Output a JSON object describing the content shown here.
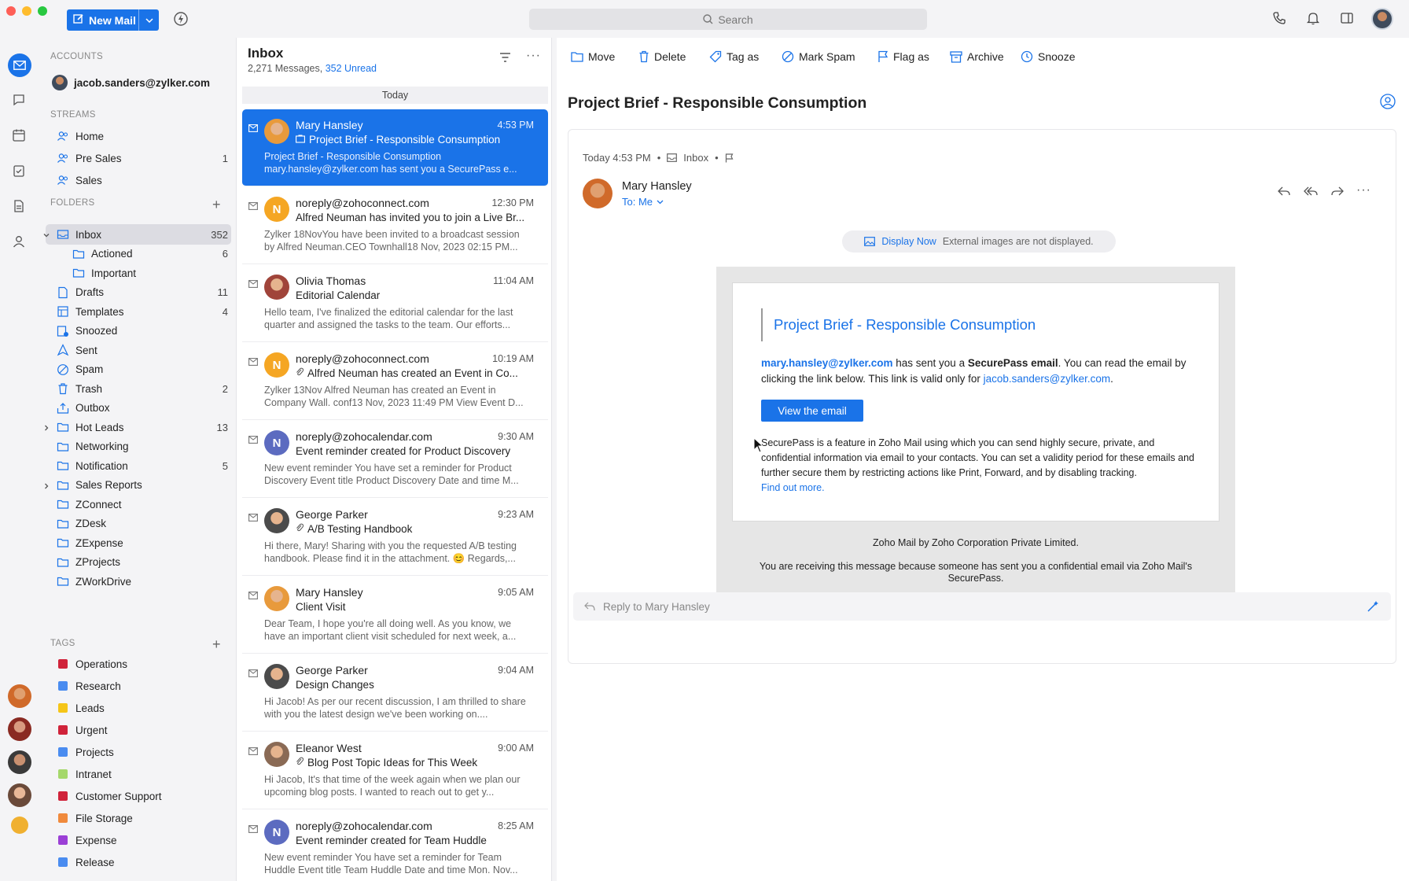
{
  "toolbar": {
    "new_mail_label": "New Mail",
    "search_placeholder": "Search"
  },
  "sidebar": {
    "accounts_header": "ACCOUNTS",
    "account_email": "jacob.sanders@zylker.com",
    "streams_header": "STREAMS",
    "streams": [
      {
        "label": "Home",
        "count": ""
      },
      {
        "label": "Pre Sales",
        "count": "1"
      },
      {
        "label": "Sales",
        "count": ""
      }
    ],
    "folders_header": "FOLDERS",
    "folders": [
      {
        "label": "Inbox",
        "count": "352"
      },
      {
        "label": "Actioned",
        "count": "6"
      },
      {
        "label": "Important",
        "count": ""
      },
      {
        "label": "Drafts",
        "count": "11"
      },
      {
        "label": "Templates",
        "count": "4"
      },
      {
        "label": "Snoozed",
        "count": ""
      },
      {
        "label": "Sent",
        "count": ""
      },
      {
        "label": "Spam",
        "count": ""
      },
      {
        "label": "Trash",
        "count": "2"
      },
      {
        "label": "Outbox",
        "count": ""
      },
      {
        "label": "Hot Leads",
        "count": "13"
      },
      {
        "label": "Networking",
        "count": ""
      },
      {
        "label": "Notification",
        "count": "5"
      },
      {
        "label": "Sales Reports",
        "count": ""
      },
      {
        "label": "ZConnect",
        "count": ""
      },
      {
        "label": "ZDesk",
        "count": ""
      },
      {
        "label": "ZExpense",
        "count": ""
      },
      {
        "label": "ZProjects",
        "count": ""
      },
      {
        "label": "ZWorkDrive",
        "count": ""
      }
    ],
    "tags_header": "TAGS",
    "tags": [
      {
        "label": "Operations",
        "color": "#d0233a"
      },
      {
        "label": "Research",
        "color": "#4a8cf0"
      },
      {
        "label": "Leads",
        "color": "#f5c518"
      },
      {
        "label": "Urgent",
        "color": "#d0233a"
      },
      {
        "label": "Projects",
        "color": "#4a8cf0"
      },
      {
        "label": "Intranet",
        "color": "#a5d86b"
      },
      {
        "label": "Customer Support",
        "color": "#d0233a"
      },
      {
        "label": "File Storage",
        "color": "#f08a3c"
      },
      {
        "label": "Expense",
        "color": "#9b3fd6"
      },
      {
        "label": "Release",
        "color": "#4a8cf0"
      }
    ]
  },
  "list": {
    "title": "Inbox",
    "count": "2,271 Messages,",
    "unread": "352 Unread",
    "section": "Today",
    "messages": [
      {
        "from": "Mary Hansley",
        "time": "4:53 PM",
        "subject": "Project Brief - Responsible Consumption",
        "preview": "Project Brief - Responsible Consumption mary.hansley@zylker.com has sent you a SecurePass e...",
        "avatar": "photo",
        "avatar_color": "#e89a3c"
      },
      {
        "from": "noreply@zohoconnect.com",
        "time": "12:30 PM",
        "subject": "Alfred Neuman has invited you to join a Live Br...",
        "preview": "Zylker 18NovYou have been invited to a broadcast session by Alfred Neuman.CEO Townhall18 Nov, 2023 02:15 PM...",
        "avatar": "N",
        "avatar_color": "#f5a623"
      },
      {
        "from": "Olivia Thomas",
        "time": "11:04 AM",
        "subject": "Editorial Calendar",
        "preview": "Hello team, I've finalized the editorial calendar for the last quarter and assigned the tasks to the team. Our efforts...",
        "avatar": "photo",
        "avatar_color": "#a0443a"
      },
      {
        "from": "noreply@zohoconnect.com",
        "time": "10:19 AM",
        "subject": "Alfred Neuman has created an Event in Co...",
        "preview": "Zylker 13Nov Alfred Neuman has created an Event in Company Wall. conf13 Nov, 2023 11:49 PM View Event D...",
        "avatar": "N",
        "avatar_color": "#f5a623"
      },
      {
        "from": "noreply@zohocalendar.com",
        "time": "9:30 AM",
        "subject": "Event reminder created for Product Discovery",
        "preview": "New event reminder You have set a reminder for Product Discovery Event title Product Discovery Date and time M...",
        "avatar": "N",
        "avatar_color": "#5c6bc0"
      },
      {
        "from": "George Parker",
        "time": "9:23 AM",
        "subject": "A/B Testing Handbook",
        "preview": "Hi there, Mary! Sharing with you the requested A/B testing handbook. Please find it in the attachment. 😊 Regards,...",
        "avatar": "photo",
        "avatar_color": "#4b4b4b"
      },
      {
        "from": "Mary Hansley",
        "time": "9:05 AM",
        "subject": "Client Visit",
        "preview": "Dear Team, I hope you're all doing well. As you know, we have an important client visit scheduled for next week, a...",
        "avatar": "photo",
        "avatar_color": "#e89a3c"
      },
      {
        "from": "George Parker",
        "time": "9:04 AM",
        "subject": "Design Changes",
        "preview": "Hi Jacob! As per our recent discussion, I am thrilled to share with you the latest design we've been working on....",
        "avatar": "photo",
        "avatar_color": "#4b4b4b"
      },
      {
        "from": "Eleanor West",
        "time": "9:00 AM",
        "subject": "Blog Post Topic Ideas for This Week",
        "preview": "Hi Jacob, It's that time of the week again when we plan our upcoming blog posts. I wanted to reach out to get y...",
        "avatar": "photo",
        "avatar_color": "#8a6a55"
      },
      {
        "from": "noreply@zohocalendar.com",
        "time": "8:25 AM",
        "subject": "Event reminder created for Team Huddle",
        "preview": "New event reminder You have set a reminder for Team Huddle Event title Team Huddle Date and time Mon. Nov...",
        "avatar": "N",
        "avatar_color": "#5c6bc0"
      }
    ]
  },
  "reader": {
    "actions": [
      "Move",
      "Delete",
      "Tag as",
      "Mark Spam",
      "Flag as",
      "Archive",
      "Snooze"
    ],
    "subject": "Project Brief - Responsible Consumption",
    "date": "Today 4:53 PM",
    "folder": "Inbox",
    "sender": "Mary Hansley",
    "to": "To: Me",
    "images_link": "Display Now",
    "images_note": "External images are not displayed.",
    "body_title": "Project Brief - Responsible Consumption",
    "body_sender_link": "mary.hansley@zylker.com",
    "body_text1": " has sent you a ",
    "body_bold": "SecurePass email",
    "body_text2": ". You can read the email by clicking the link below. This link is valid only for ",
    "body_recipient_link": "jacob.sanders@zylker.com",
    "body_text3": ".",
    "view_button": "View the email",
    "info": "SecurePass is a feature in Zoho Mail using which you can send highly secure, private, and confidential information via email to your contacts. You can set a validity period for these emails and further secure them by restricting actions like Print, Forward, and by disabling tracking.",
    "find_out": "Find out more.",
    "footer1": "Zoho Mail by Zoho Corporation Private Limited.",
    "footer2": "You are receiving this message because someone has sent you a confidential email via Zoho Mail's SecurePass.",
    "reply_placeholder": "Reply to Mary Hansley"
  }
}
